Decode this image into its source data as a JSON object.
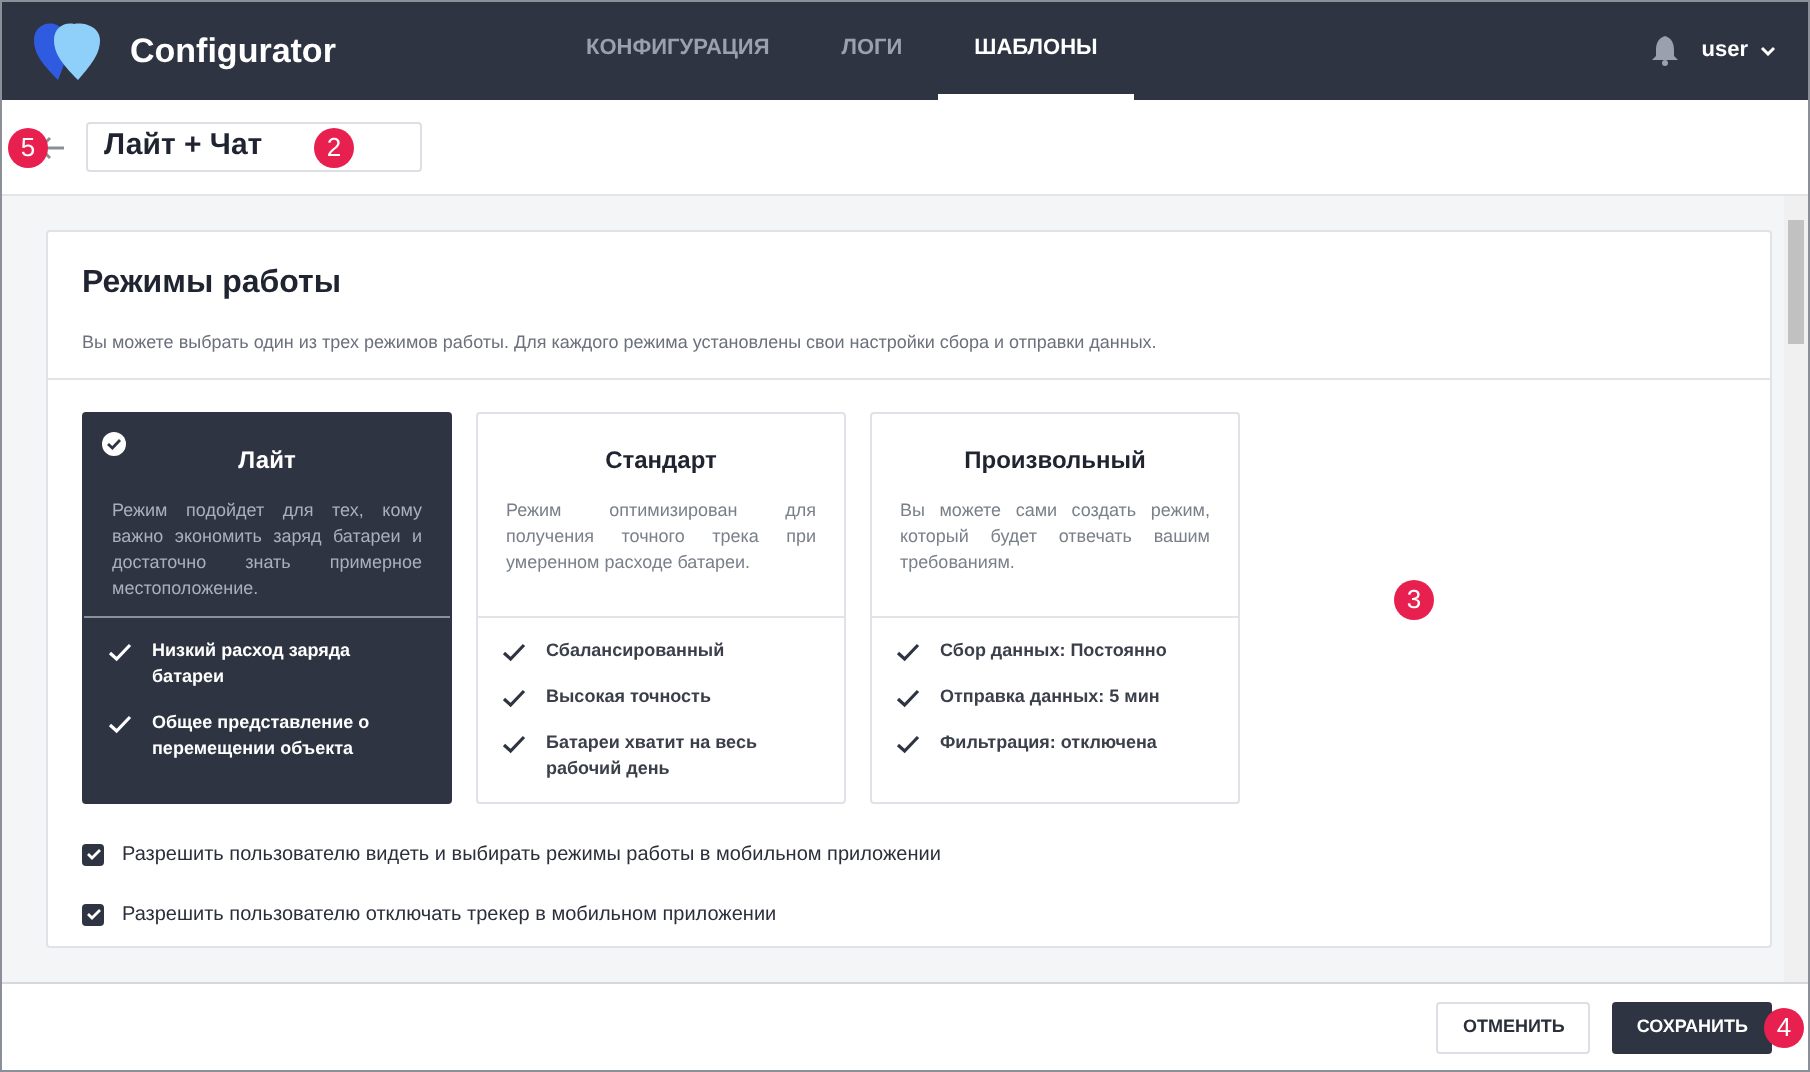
{
  "header": {
    "app_name": "Configurator",
    "nav": [
      {
        "label": "КОНФИГУРАЦИЯ",
        "selected": false
      },
      {
        "label": "ЛОГИ",
        "selected": false
      },
      {
        "label": "ШАБЛОНЫ",
        "selected": true
      }
    ],
    "user": "user"
  },
  "template_name": "Лайт + Чат",
  "section": {
    "title": "Режимы работы",
    "subtitle": "Вы можете выбрать один из трех режимов работы. Для каждого режима установлены свои настройки сбора и отправки данных.",
    "modes": [
      {
        "title": "Лайт",
        "description": "Режим подойдет для тех, кому важно экономить заряд батареи и достаточно знать примерное местоположение.",
        "selected": true,
        "features": [
          "Низкий расход заряда батареи",
          "Общее представление о перемещении объекта"
        ]
      },
      {
        "title": "Стандарт",
        "description": "Режим оптимизирован для получения точного трека при умеренном расходе батареи.",
        "selected": false,
        "features": [
          "Сбалансированный",
          "Высокая точность",
          "Батареи хватит на весь рабочий день"
        ]
      },
      {
        "title": "Произвольный",
        "description": "Вы можете сами создать режим, который будет отвечать вашим требованиям.",
        "selected": false,
        "features": [
          "Сбор данных: Постоянно",
          "Отправка данных: 5 мин",
          "Фильтрация: отключена"
        ]
      }
    ],
    "options": [
      {
        "label": "Разрешить пользователю видеть и выбирать режимы работы в мобильном приложении",
        "checked": true
      },
      {
        "label": "Разрешить пользователю отключать трекер в мобильном приложении",
        "checked": true
      }
    ]
  },
  "footer": {
    "buttons": [
      {
        "label": "ОТМЕНИТЬ",
        "kind": "secondary"
      },
      {
        "label": "СОХРАНИТЬ",
        "kind": "primary"
      }
    ]
  },
  "callouts": [
    "5",
    "2",
    "3",
    "4"
  ]
}
